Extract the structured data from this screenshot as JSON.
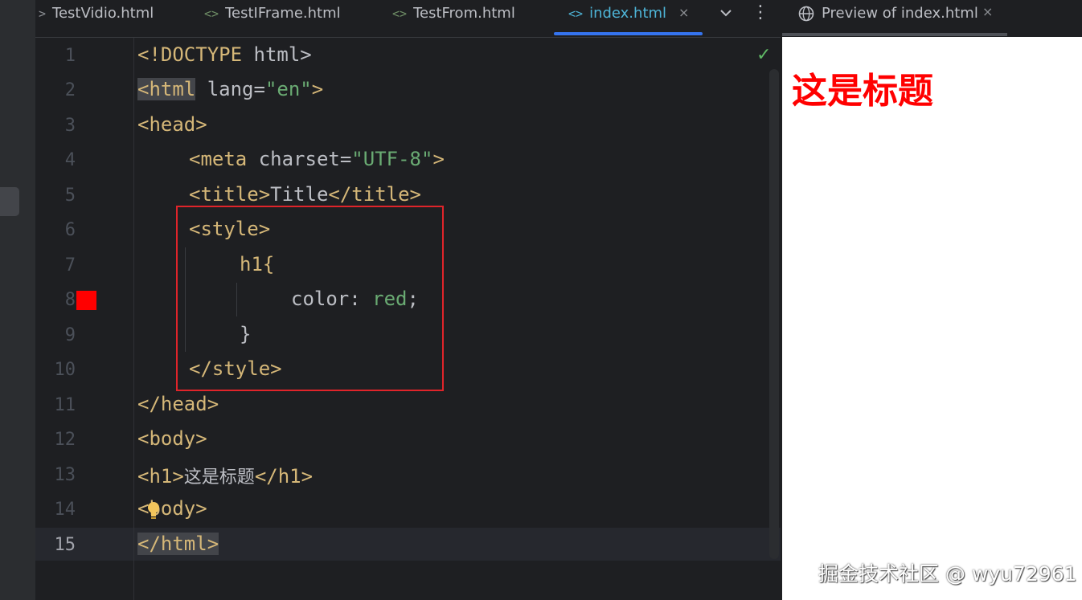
{
  "colors": {
    "accent": "#3574f0",
    "preview_heading": "#ff0000",
    "gutter_swatch": "#ff0000",
    "annotation_box": "#e0242a"
  },
  "tabs": [
    {
      "label": "TestVidio.html",
      "icon": ">"
    },
    {
      "label": "TestIFrame.html",
      "icon": "<>"
    },
    {
      "label": "TestFrom.html",
      "icon": "<>"
    },
    {
      "label": "index.html",
      "icon": "<>",
      "active": true,
      "close": "×"
    }
  ],
  "tabbar": {
    "more_icon": "chevron-down-icon",
    "menu_icon": "kebab-icon",
    "menu_glyph": "⋮"
  },
  "editor": {
    "status_icon": "check-icon",
    "status_glyph": "✓",
    "current_line": 15,
    "line_numbers": [
      "1",
      "2",
      "3",
      "4",
      "5",
      "6",
      "7",
      "8",
      "9",
      "10",
      "11",
      "12",
      "13",
      "14",
      "15"
    ],
    "lines": {
      "l1_doctype": "<!DOCTYPE",
      "l1_html": " html>",
      "l2_open": "<html",
      "l2_attr": " lang=",
      "l2_val": "\"en\"",
      "l2_close": ">",
      "l3": "<head>",
      "l4_open": "<meta",
      "l4_attr": " charset=",
      "l4_val": "\"UTF-8\"",
      "l4_close": ">",
      "l5_open": "<title>",
      "l5_text": "Title",
      "l5_close": "</title>",
      "l6": "<style>",
      "l7": "h1{",
      "l8_prop": "color: ",
      "l8_val": "red",
      "l8_semi": ";",
      "l9": "}",
      "l10": "</style>",
      "l11": "</head>",
      "l12": "<body>",
      "l13_open": "<h1>",
      "l13_text": "这是标题",
      "l13_close": "</h1>",
      "l14_lt": "<",
      "l14_rest": "body>",
      "l15": "</html>"
    }
  },
  "preview": {
    "tab_label": "Preview of index.html",
    "tab_close": "×",
    "heading": "这是标题"
  },
  "watermark": "掘金技术社区 @ wyu72961"
}
